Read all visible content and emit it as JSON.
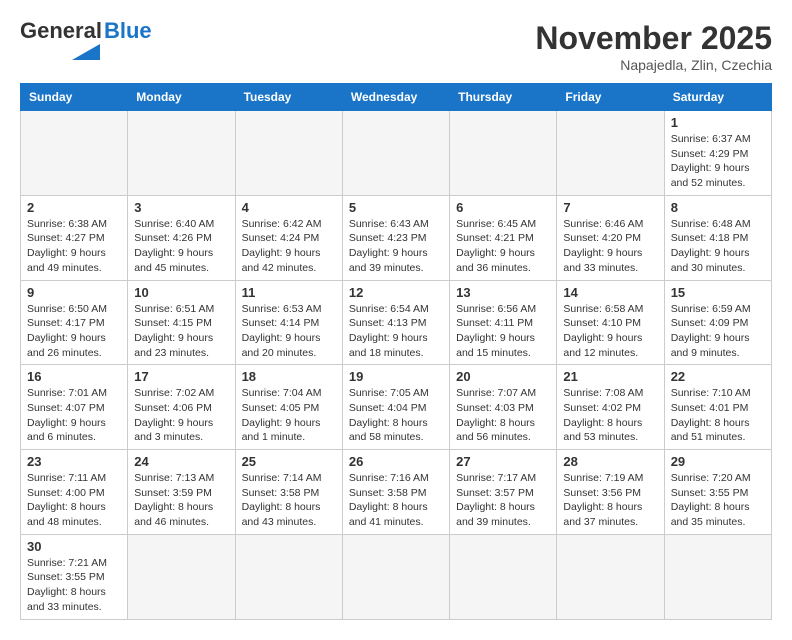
{
  "header": {
    "logo_general": "General",
    "logo_blue": "Blue",
    "month_year": "November 2025",
    "location": "Napajedla, Zlin, Czechia"
  },
  "days_of_week": [
    "Sunday",
    "Monday",
    "Tuesday",
    "Wednesday",
    "Thursday",
    "Friday",
    "Saturday"
  ],
  "weeks": [
    [
      {
        "day": "",
        "info": ""
      },
      {
        "day": "",
        "info": ""
      },
      {
        "day": "",
        "info": ""
      },
      {
        "day": "",
        "info": ""
      },
      {
        "day": "",
        "info": ""
      },
      {
        "day": "",
        "info": ""
      },
      {
        "day": "1",
        "info": "Sunrise: 6:37 AM\nSunset: 4:29 PM\nDaylight: 9 hours and 52 minutes."
      }
    ],
    [
      {
        "day": "2",
        "info": "Sunrise: 6:38 AM\nSunset: 4:27 PM\nDaylight: 9 hours and 49 minutes."
      },
      {
        "day": "3",
        "info": "Sunrise: 6:40 AM\nSunset: 4:26 PM\nDaylight: 9 hours and 45 minutes."
      },
      {
        "day": "4",
        "info": "Sunrise: 6:42 AM\nSunset: 4:24 PM\nDaylight: 9 hours and 42 minutes."
      },
      {
        "day": "5",
        "info": "Sunrise: 6:43 AM\nSunset: 4:23 PM\nDaylight: 9 hours and 39 minutes."
      },
      {
        "day": "6",
        "info": "Sunrise: 6:45 AM\nSunset: 4:21 PM\nDaylight: 9 hours and 36 minutes."
      },
      {
        "day": "7",
        "info": "Sunrise: 6:46 AM\nSunset: 4:20 PM\nDaylight: 9 hours and 33 minutes."
      },
      {
        "day": "8",
        "info": "Sunrise: 6:48 AM\nSunset: 4:18 PM\nDaylight: 9 hours and 30 minutes."
      }
    ],
    [
      {
        "day": "9",
        "info": "Sunrise: 6:50 AM\nSunset: 4:17 PM\nDaylight: 9 hours and 26 minutes."
      },
      {
        "day": "10",
        "info": "Sunrise: 6:51 AM\nSunset: 4:15 PM\nDaylight: 9 hours and 23 minutes."
      },
      {
        "day": "11",
        "info": "Sunrise: 6:53 AM\nSunset: 4:14 PM\nDaylight: 9 hours and 20 minutes."
      },
      {
        "day": "12",
        "info": "Sunrise: 6:54 AM\nSunset: 4:13 PM\nDaylight: 9 hours and 18 minutes."
      },
      {
        "day": "13",
        "info": "Sunrise: 6:56 AM\nSunset: 4:11 PM\nDaylight: 9 hours and 15 minutes."
      },
      {
        "day": "14",
        "info": "Sunrise: 6:58 AM\nSunset: 4:10 PM\nDaylight: 9 hours and 12 minutes."
      },
      {
        "day": "15",
        "info": "Sunrise: 6:59 AM\nSunset: 4:09 PM\nDaylight: 9 hours and 9 minutes."
      }
    ],
    [
      {
        "day": "16",
        "info": "Sunrise: 7:01 AM\nSunset: 4:07 PM\nDaylight: 9 hours and 6 minutes."
      },
      {
        "day": "17",
        "info": "Sunrise: 7:02 AM\nSunset: 4:06 PM\nDaylight: 9 hours and 3 minutes."
      },
      {
        "day": "18",
        "info": "Sunrise: 7:04 AM\nSunset: 4:05 PM\nDaylight: 9 hours and 1 minute."
      },
      {
        "day": "19",
        "info": "Sunrise: 7:05 AM\nSunset: 4:04 PM\nDaylight: 8 hours and 58 minutes."
      },
      {
        "day": "20",
        "info": "Sunrise: 7:07 AM\nSunset: 4:03 PM\nDaylight: 8 hours and 56 minutes."
      },
      {
        "day": "21",
        "info": "Sunrise: 7:08 AM\nSunset: 4:02 PM\nDaylight: 8 hours and 53 minutes."
      },
      {
        "day": "22",
        "info": "Sunrise: 7:10 AM\nSunset: 4:01 PM\nDaylight: 8 hours and 51 minutes."
      }
    ],
    [
      {
        "day": "23",
        "info": "Sunrise: 7:11 AM\nSunset: 4:00 PM\nDaylight: 8 hours and 48 minutes."
      },
      {
        "day": "24",
        "info": "Sunrise: 7:13 AM\nSunset: 3:59 PM\nDaylight: 8 hours and 46 minutes."
      },
      {
        "day": "25",
        "info": "Sunrise: 7:14 AM\nSunset: 3:58 PM\nDaylight: 8 hours and 43 minutes."
      },
      {
        "day": "26",
        "info": "Sunrise: 7:16 AM\nSunset: 3:58 PM\nDaylight: 8 hours and 41 minutes."
      },
      {
        "day": "27",
        "info": "Sunrise: 7:17 AM\nSunset: 3:57 PM\nDaylight: 8 hours and 39 minutes."
      },
      {
        "day": "28",
        "info": "Sunrise: 7:19 AM\nSunset: 3:56 PM\nDaylight: 8 hours and 37 minutes."
      },
      {
        "day": "29",
        "info": "Sunrise: 7:20 AM\nSunset: 3:55 PM\nDaylight: 8 hours and 35 minutes."
      }
    ],
    [
      {
        "day": "30",
        "info": "Sunrise: 7:21 AM\nSunset: 3:55 PM\nDaylight: 8 hours and 33 minutes."
      },
      {
        "day": "",
        "info": ""
      },
      {
        "day": "",
        "info": ""
      },
      {
        "day": "",
        "info": ""
      },
      {
        "day": "",
        "info": ""
      },
      {
        "day": "",
        "info": ""
      },
      {
        "day": "",
        "info": ""
      }
    ]
  ]
}
